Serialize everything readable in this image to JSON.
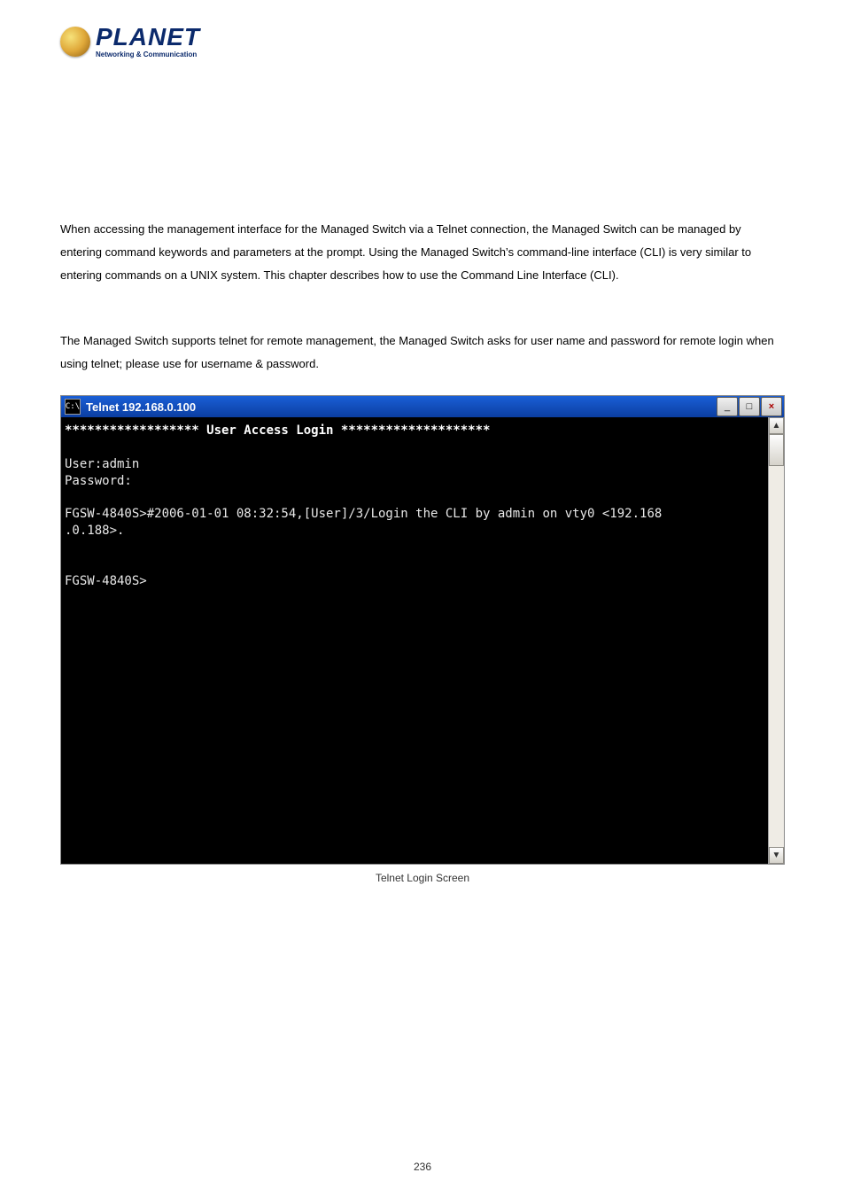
{
  "logo": {
    "brand": "PLANET",
    "tagline": "Networking & Communication"
  },
  "paragraph1": "When accessing the management interface for the Managed Switch via a Telnet connection, the Managed Switch can be managed by entering command keywords and parameters at the prompt. Using the Managed Switch’s command-line interface (CLI) is very similar to entering commands on a UNIX system. This chapter describes how to use the Command Line Interface (CLI).",
  "paragraph2_pre": "The Managed Switch supports telnet for remote management, the Managed Switch asks for user name and password for remote login when using telnet; please use ",
  "paragraph2_post": " for username & password.",
  "credentials_hint": "",
  "telnet": {
    "titlebar_icon_text": "C:\\",
    "title": "Telnet 192.168.0.100",
    "controls": {
      "minimize": "_",
      "maximize": "□",
      "close": "×"
    },
    "lines": {
      "banner": "****************** User Access Login ********************",
      "blank": "",
      "user": "User:admin",
      "password": "Password:",
      "log_a": "FGSW-4840S>#2006-01-01 08:32:54,[User]/3/Login the CLI by admin on vty0 <192.168",
      "log_b": ".0.188>.",
      "prompt": "FGSW-4840S>"
    },
    "scroll": {
      "up": "▲",
      "down": "▼"
    }
  },
  "figure_caption": "Telnet Login Screen",
  "page_number": "236"
}
